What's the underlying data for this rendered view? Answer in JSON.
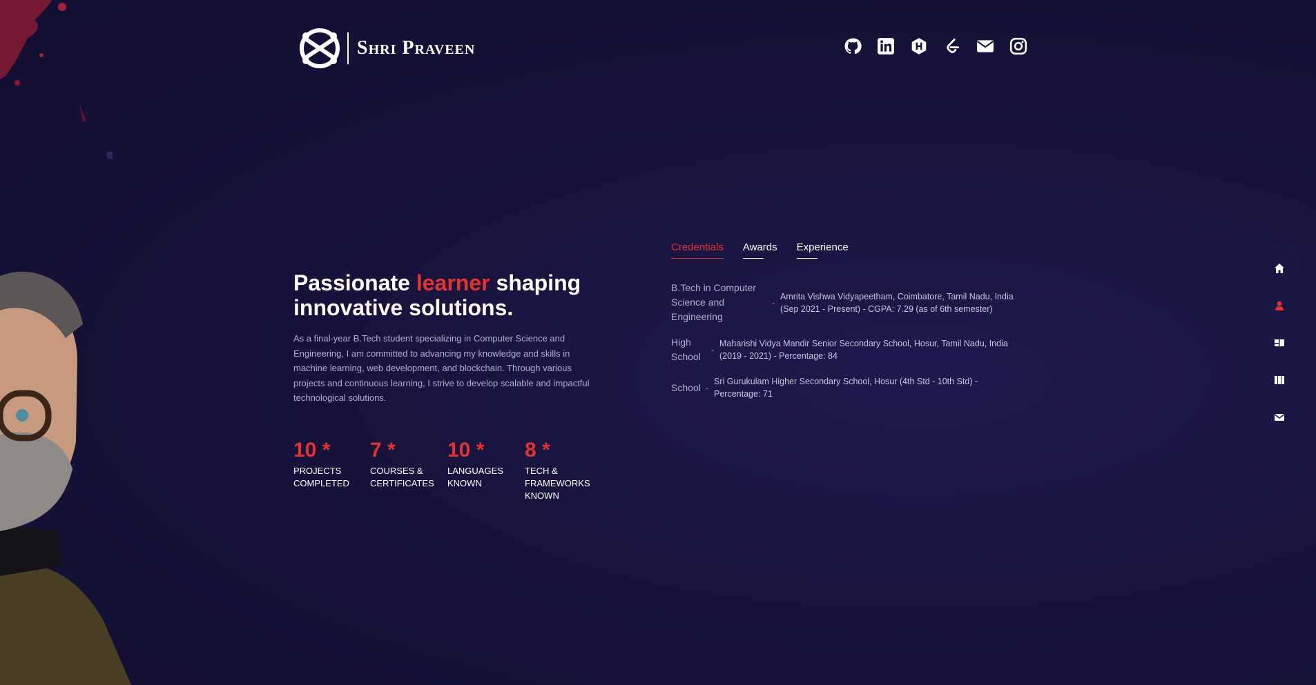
{
  "brand": {
    "name": "Shri Praveen"
  },
  "social_links": [
    {
      "icon": "github-icon"
    },
    {
      "icon": "linkedin-icon"
    },
    {
      "icon": "hashnode-icon"
    },
    {
      "icon": "leetcode-icon"
    },
    {
      "icon": "email-icon"
    },
    {
      "icon": "instagram-icon"
    }
  ],
  "hero": {
    "headline_before": "Passionate ",
    "headline_accent": "learner",
    "headline_after": " shaping innovative solutions.",
    "description": "As a final-year B.Tech student specializing in Computer Science and Engineering, I am committed to advancing my knowledge and skills in machine learning, web development, and blockchain. Through various projects and continuous learning, I strive to develop scalable and impactful technological solutions."
  },
  "stats": [
    {
      "value": "10 *",
      "label": "Projects Completed"
    },
    {
      "value": "7 *",
      "label": "Courses & Certificates"
    },
    {
      "value": "10 *",
      "label": "Languages Known"
    },
    {
      "value": "8 *",
      "label": "Tech & Frameworks Known"
    }
  ],
  "tabs": [
    {
      "label": "Credentials",
      "active": true
    },
    {
      "label": "Awards",
      "active": false
    },
    {
      "label": "Experience",
      "active": false
    }
  ],
  "credentials": [
    {
      "title": "B.Tech in Computer Science and Engineering",
      "separator": "-",
      "detail": "Amrita Vishwa Vidyapeetham, Coimbatore, Tamil Nadu, India (Sep 2021 - Present) - CGPA: 7.29 (as of 6th semester)"
    },
    {
      "title": "High School",
      "separator": "-",
      "detail": "Maharishi Vidya Mandir Senior Secondary School, Hosur, Tamil Nadu, India (2019 - 2021) - Percentage: 84"
    },
    {
      "title": "School",
      "separator": "-",
      "detail": "Sri Gurukulam Higher Secondary School, Hosur (4th Std - 10th Std) - Percentage: 71"
    }
  ],
  "side_nav": [
    {
      "icon": "home-icon",
      "active": false
    },
    {
      "icon": "user-icon",
      "active": true
    },
    {
      "icon": "services-icon",
      "active": false
    },
    {
      "icon": "portfolio-icon",
      "active": false
    },
    {
      "icon": "contact-icon",
      "active": false
    }
  ],
  "colors": {
    "accent": "#e3332e",
    "background": "#17133c",
    "muted_text": "#b2aed0"
  }
}
